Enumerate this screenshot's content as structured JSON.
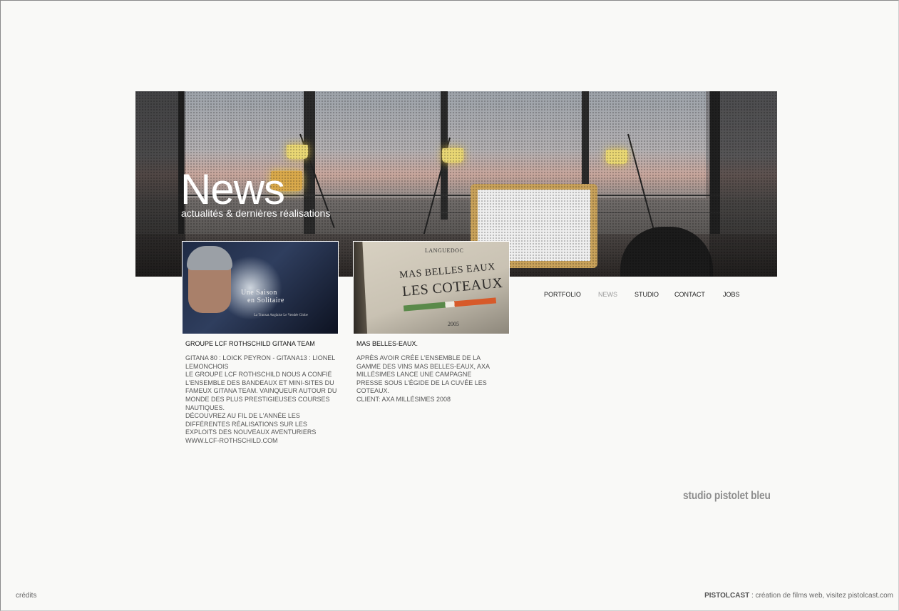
{
  "hero": {
    "title": "News",
    "subtitle": "actualités & dernières réalisations"
  },
  "nav": {
    "items": [
      {
        "label": "PORTFOLIO",
        "active": false
      },
      {
        "label": "NEWS",
        "active": true
      },
      {
        "label": "STUDIO",
        "active": false
      },
      {
        "label": "CONTACT",
        "active": false
      },
      {
        "label": "JOBS",
        "active": false
      }
    ]
  },
  "news": [
    {
      "thumb_text_1": "Une Saison",
      "thumb_text_2": "en Solitaire",
      "thumb_small": "La Transat Anglaise      Le Vendée Globe",
      "title": "GROUPE LCF ROTHSCHILD GITANA TEAM",
      "body": "GITANA 80 : LOICK PEYRON - GITANA13 : LIONEL LEMONCHOIS\nLE GROUPE LCF  ROTHSCHILD NOUS A CONFIÉ L'ENSEMBLE DES BANDEAUX ET MINI-SITES DU FAMEUX GITANA TEAM. VAINQUEUR AUTOUR DU MONDE DES PLUS PRESTIGIEUSES COURSES NAUTIQUES.\nDÉCOUVREZ AU FIL DE L'ANNÉE LES DIFFÉRENTES RÉALISATIONS SUR LES EXPLOITS DES NOUVEAUX AVENTURIERS\nWWW.LCF-ROTHSCHILD.COM"
    },
    {
      "thumb_top": "LANGUEDOC",
      "thumb_line1": "MAS BELLES EAUX",
      "thumb_line2": "LES COTEAUX",
      "thumb_year": "2005",
      "title": "MAS BELLES-EAUX.",
      "body": "APRÈS AVOIR CRÉE L'ENSEMBLE DE LA GAMME DES VINS MAS BELLES-EAUX, AXA MILLÉSIMES LANCE UNE CAMPAGNE PRESSE SOUS L'ÉGIDE DE LA CUVÉE LES COTEAUX.\nCLIENT: AXA MILLÉSIMES 2008"
    }
  ],
  "brand": "studio pistolet bleu",
  "footer": {
    "credits": "crédits",
    "company": "PISTOLCAST",
    "tagline": " : création de films web, visitez pistolcast.com"
  }
}
